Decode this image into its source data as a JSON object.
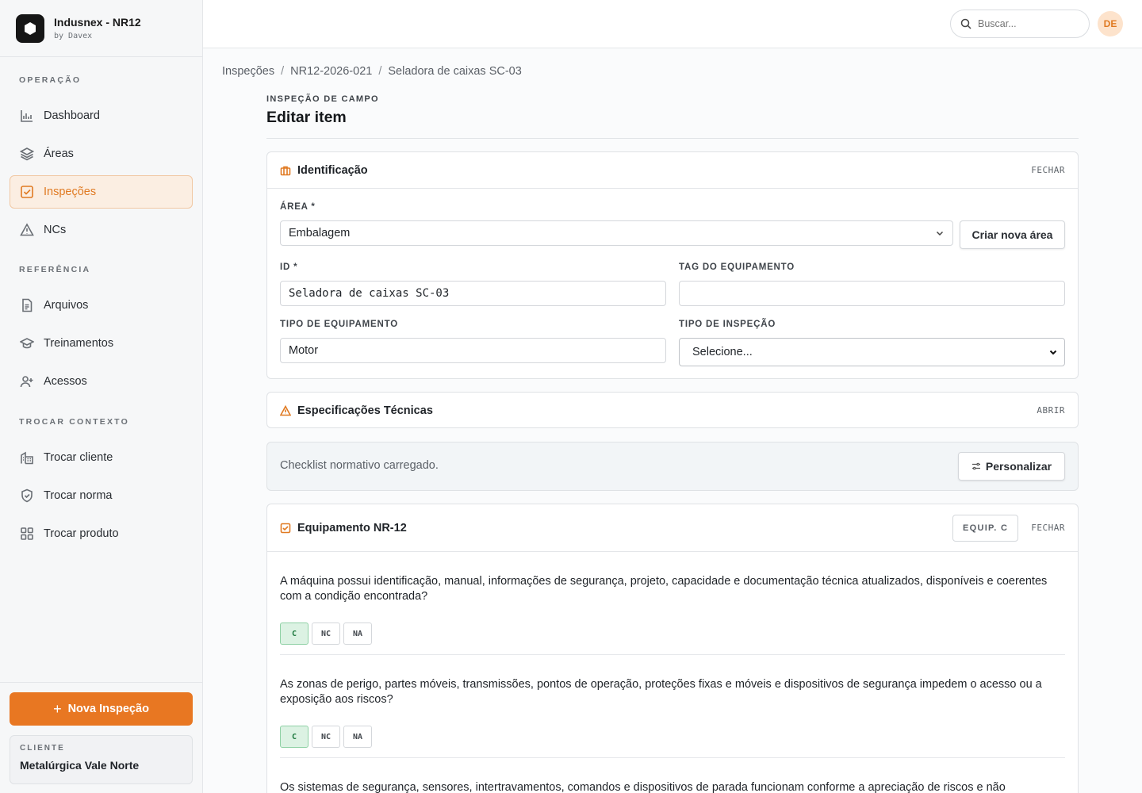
{
  "brand": {
    "name": "Indusnex - NR12",
    "sub": "by Davex"
  },
  "nav": {
    "operacao_head": "OPERAÇÃO",
    "operacao": [
      {
        "label": "Dashboard",
        "icon": "chart-icon"
      },
      {
        "label": "Áreas",
        "icon": "layers-icon"
      },
      {
        "label": "Inspeções",
        "icon": "checkbox-icon",
        "active": true
      },
      {
        "label": "NCs",
        "icon": "warning-icon"
      }
    ],
    "referencia_head": "REFERÊNCIA",
    "referencia": [
      {
        "label": "Arquivos",
        "icon": "file-icon"
      },
      {
        "label": "Treinamentos",
        "icon": "graduation-icon"
      },
      {
        "label": "Acessos",
        "icon": "user-plus-icon"
      }
    ],
    "contexto_head": "TROCAR CONTEXTO",
    "contexto": [
      {
        "label": "Trocar cliente",
        "icon": "building-icon"
      },
      {
        "label": "Trocar norma",
        "icon": "shield-icon"
      },
      {
        "label": "Trocar produto",
        "icon": "grid-icon"
      }
    ]
  },
  "sidebar_bottom": {
    "new_inspection": "Nova Inspeção",
    "client_label": "CLIENTE",
    "client_name": "Metalúrgica Vale Norte"
  },
  "topbar": {
    "search_placeholder": "Buscar...",
    "avatar": "DE"
  },
  "breadcrumb": [
    "Inspeções",
    "NR12-2026-021",
    "Seladora de caixas SC-03"
  ],
  "page": {
    "kicker": "INSPEÇÃO DE CAMPO",
    "title": "Editar item"
  },
  "identificacao": {
    "title": "Identificação",
    "toggle": "FECHAR",
    "area_label": "ÁREA *",
    "area_value": "Embalagem",
    "create_area": "Criar nova área",
    "id_label": "ID *",
    "id_value": "Seladora de caixas SC-03",
    "tag_label": "TAG DO EQUIPAMENTO",
    "tag_value": "",
    "tipo_equip_label": "TIPO DE EQUIPAMENTO",
    "tipo_equip_value": "Motor",
    "tipo_insp_label": "TIPO DE INSPEÇÃO",
    "tipo_insp_value": "Selecione..."
  },
  "especificacoes": {
    "title": "Especificações Técnicas",
    "toggle": "ABRIR"
  },
  "checklist_banner": {
    "text": "Checklist normativo carregado.",
    "button": "Personalizar"
  },
  "equipamento": {
    "title": "Equipamento NR-12",
    "badge": "EQUIP. C",
    "toggle": "FECHAR",
    "questions": [
      {
        "text": "A máquina possui identificação, manual, informações de segurança, projeto, capacidade e documentação técnica atualizados, disponíveis e coerentes com a condição encontrada?",
        "options": [
          "C",
          "NC",
          "NA"
        ],
        "selected": "C"
      },
      {
        "text": "As zonas de perigo, partes móveis, transmissões, pontos de operação, proteções fixas e móveis e dispositivos de segurança impedem o acesso ou a exposição aos riscos?",
        "options": [
          "C",
          "NC",
          "NA"
        ],
        "selected": "C"
      },
      {
        "text": "Os sistemas de segurança, sensores, intertravamentos, comandos e dispositivos de parada funcionam conforme a apreciação de riscos e não",
        "options": [],
        "selected": ""
      }
    ]
  },
  "colors": {
    "accent": "#e87722",
    "success": "#1f7a40"
  }
}
